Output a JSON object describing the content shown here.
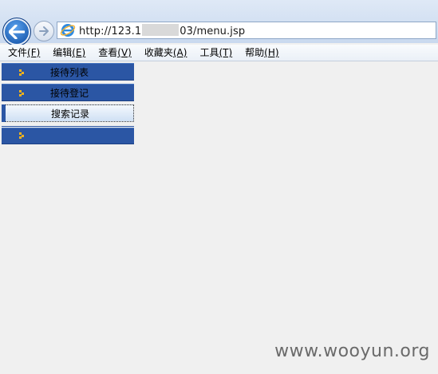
{
  "browser": {
    "url_prefix": "http://123.1",
    "url_suffix": "03/menu.jsp",
    "icons": {
      "back": "back-arrow-icon",
      "forward": "forward-arrow-icon",
      "site": "ie-logo-icon"
    }
  },
  "menubar": {
    "items": [
      {
        "label": "文件",
        "key": "(F)"
      },
      {
        "label": "编辑",
        "key": "(E)"
      },
      {
        "label": "查看",
        "key": "(V)"
      },
      {
        "label": "收藏夹",
        "key": "(A)"
      },
      {
        "label": "工具",
        "key": "(T)"
      },
      {
        "label": "帮助",
        "key": "(H)"
      }
    ]
  },
  "nav": {
    "items": [
      {
        "label": "接待列表"
      },
      {
        "label": "接待登记"
      },
      {
        "label": "搜索记录"
      },
      {
        "label": ""
      }
    ]
  },
  "watermark": "www.wooyun.org",
  "colors": {
    "nav_bg": "#2b56a4",
    "bullet": "#f2b21c"
  }
}
